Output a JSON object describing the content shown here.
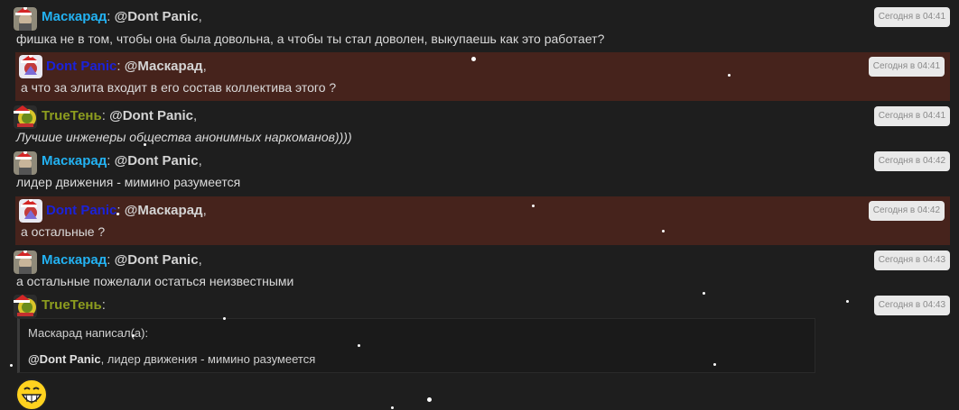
{
  "colors": {
    "background": "#1e1e1e",
    "highlight_background": "#46231c",
    "user_maskarad": "#23b2f2",
    "user_dont_panic": "#1b22d8",
    "user_truet": "#8d9d1f"
  },
  "messages": [
    {
      "username": "Маскарад",
      "separator": ":",
      "mention": "@Dont Panic",
      "mention_suffix": ",",
      "text": "фишка не в том, чтобы она была довольна, а чтобы ты стал доволен, выкупаешь как это работает?",
      "time": "Сегодня в 04:41"
    },
    {
      "username": "Dont Panic",
      "separator": ":",
      "mention": "@Маскарад",
      "mention_suffix": ",",
      "text": "а что за элита входит в его состав коллектива этого ?",
      "time": "Сегодня в 04:41"
    },
    {
      "username": "TrueТень",
      "separator": ":",
      "mention": "@Dont Panic",
      "mention_suffix": ",",
      "text": "Лучшие инженеры общества анонимных наркоманов))))",
      "time": "Сегодня в 04:41"
    },
    {
      "username": "Маскарад",
      "separator": ":",
      "mention": "@Dont Panic",
      "mention_suffix": ",",
      "text": "лидер движения - мимино разумеется",
      "time": "Сегодня в 04:42"
    },
    {
      "username": "Dont Panic",
      "separator": ":",
      "mention": "@Маскарад",
      "mention_suffix": ",",
      "text": "а остальные ?",
      "time": "Сегодня в 04:42"
    },
    {
      "username": "Маскарад",
      "separator": ":",
      "mention": "@Dont Panic",
      "mention_suffix": ",",
      "text": "а остальные пожелали остаться неизвестными",
      "time": "Сегодня в 04:43"
    },
    {
      "username": "TrueТень",
      "separator": ":",
      "time": "Сегодня в 04:43",
      "quote": {
        "author_line": "Маскарад написал(а):",
        "mention": "@Dont Panic",
        "text": ", лидер движения - мимино разумеется"
      },
      "smiley_icon": "grinning-face-icon"
    }
  ],
  "icons": {
    "avatar_hat": "santa-hat-icon"
  }
}
